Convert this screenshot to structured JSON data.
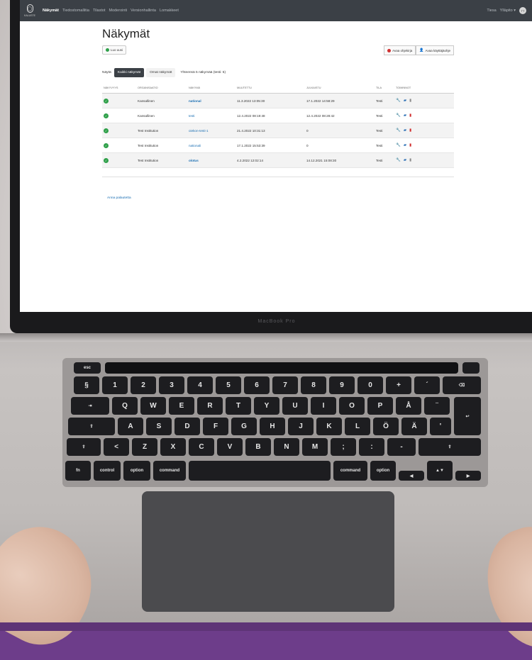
{
  "app": {
    "brand_name": "KALUSTE",
    "nav": [
      "Näkymät",
      "Tiedostomallitia",
      "Tilastot",
      "Moderointi",
      "Versionhallinta",
      "Lomakkeet"
    ],
    "nav_active_index": 0,
    "user_name": "Tiesa",
    "language": "Ylläpito ▾",
    "avatar_initials": "TT"
  },
  "page": {
    "title": "Näkymät",
    "new_button_label": "Luo uusi",
    "guide_button_label": "Avaa ohjekirja",
    "user_guide_button_label": "Avaa käyttäjäohje",
    "filter_label": "Näytä:",
    "filter_all": "Kaikki näkymät",
    "filter_own": "Omat näkymät",
    "total_text": "Yhteensä 5 näkymää (testi: 5)",
    "feedback_link": "Anna palautetta"
  },
  "table": {
    "headers": [
      "Näkyvyys",
      "Organisaatio",
      "Näkymä",
      "Muutettu",
      "Julkaistu",
      "Tila",
      "Toiminnot"
    ],
    "rows": [
      {
        "org": "Kansallinen",
        "view": "national",
        "modified": "11.3.2022 13:05:30",
        "published": "17.1.2022 14:58:29",
        "status": "Testi"
      },
      {
        "org": "Kansallinen",
        "view": "testi",
        "modified": "12.4.2022 08:19:48",
        "published": "12.4.2022 08:28:42",
        "status": "Testi"
      },
      {
        "org": "Test Institution",
        "view": "oiekon-testi-1",
        "modified": "21.4.2022 10:31:13",
        "published": "0",
        "status": "Testi"
      },
      {
        "org": "Test Institution",
        "view": "nationali",
        "modified": "17.1.2022 15:53:39",
        "published": "0",
        "status": "Testi"
      },
      {
        "org": "Test Institution",
        "view": "olotus",
        "modified": "4.2.2022 12:02:14",
        "published": "14.12.2021 15:08:30",
        "status": "Testi"
      }
    ]
  },
  "device": {
    "model_label": "MacBook Pro"
  },
  "keyboard": {
    "row0": [
      "esc"
    ],
    "row1": [
      "§",
      "1",
      "2",
      "3",
      "4",
      "5",
      "6",
      "7",
      "8",
      "9",
      "0",
      "+",
      "´",
      "⌫"
    ],
    "row2": [
      "⇥",
      "Q",
      "W",
      "E",
      "R",
      "T",
      "Y",
      "U",
      "I",
      "O",
      "P",
      "Å",
      "¨",
      "↩"
    ],
    "row3": [
      "⇪",
      "A",
      "S",
      "D",
      "F",
      "G",
      "H",
      "J",
      "K",
      "L",
      "Ö",
      "Ä",
      "'"
    ],
    "row4": [
      "⇧",
      "<",
      "Z",
      "X",
      "C",
      "V",
      "B",
      "N",
      "M",
      ";",
      ":",
      "-",
      "⇧"
    ],
    "row5": [
      "fn",
      "control",
      "option",
      "command",
      "",
      "command",
      "option",
      "◀",
      "▲▼",
      "▶"
    ]
  },
  "colors": {
    "navbar": "#3b4046",
    "link": "#1b6fb3",
    "status_green": "#2fa04a",
    "delete_red": "#d02a2a",
    "frame_purple": "#6d3d8a"
  }
}
